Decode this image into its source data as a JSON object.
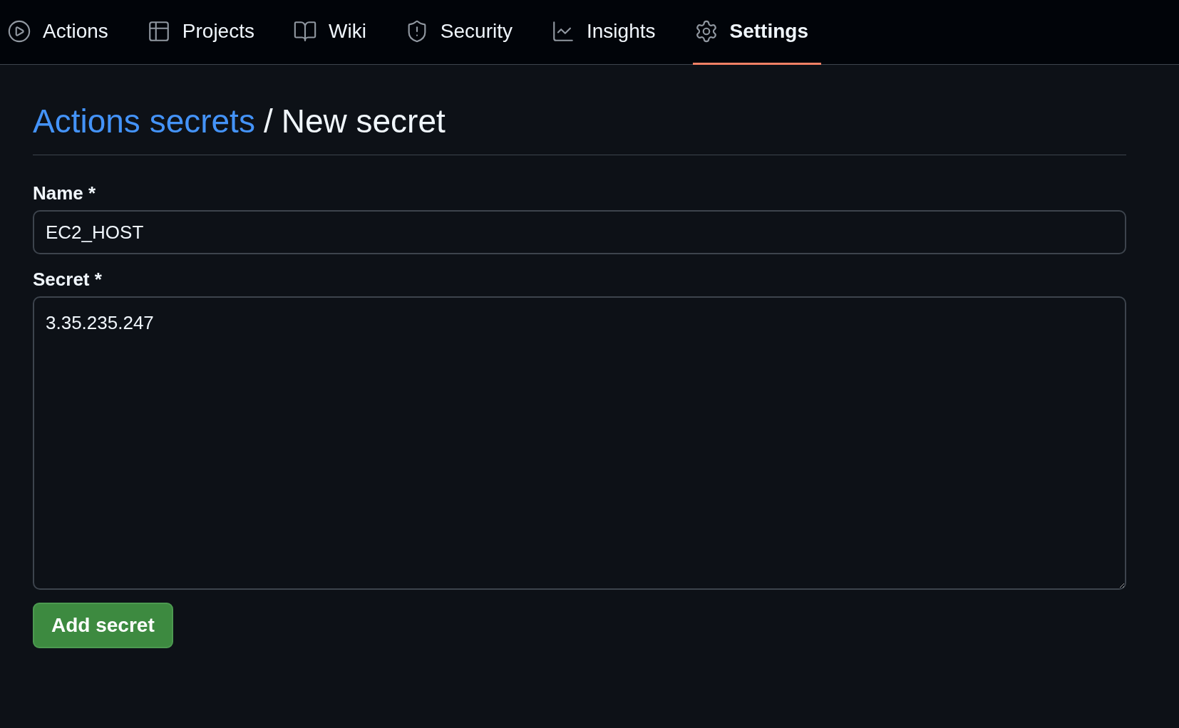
{
  "tabs": [
    {
      "label": "Actions",
      "kind": "play",
      "selected": false
    },
    {
      "label": "Projects",
      "kind": "table",
      "selected": false
    },
    {
      "label": "Wiki",
      "kind": "book",
      "selected": false
    },
    {
      "label": "Security",
      "kind": "shield",
      "selected": false
    },
    {
      "label": "Insights",
      "kind": "graph",
      "selected": false
    },
    {
      "label": "Settings",
      "kind": "gear",
      "selected": true
    }
  ],
  "heading": {
    "link": "Actions secrets",
    "separator": "/",
    "title": "New secret"
  },
  "form": {
    "name_label": "Name *",
    "name_value": "EC2_HOST",
    "secret_label": "Secret *",
    "secret_value": "3.35.235.247",
    "submit": "Add secret"
  }
}
